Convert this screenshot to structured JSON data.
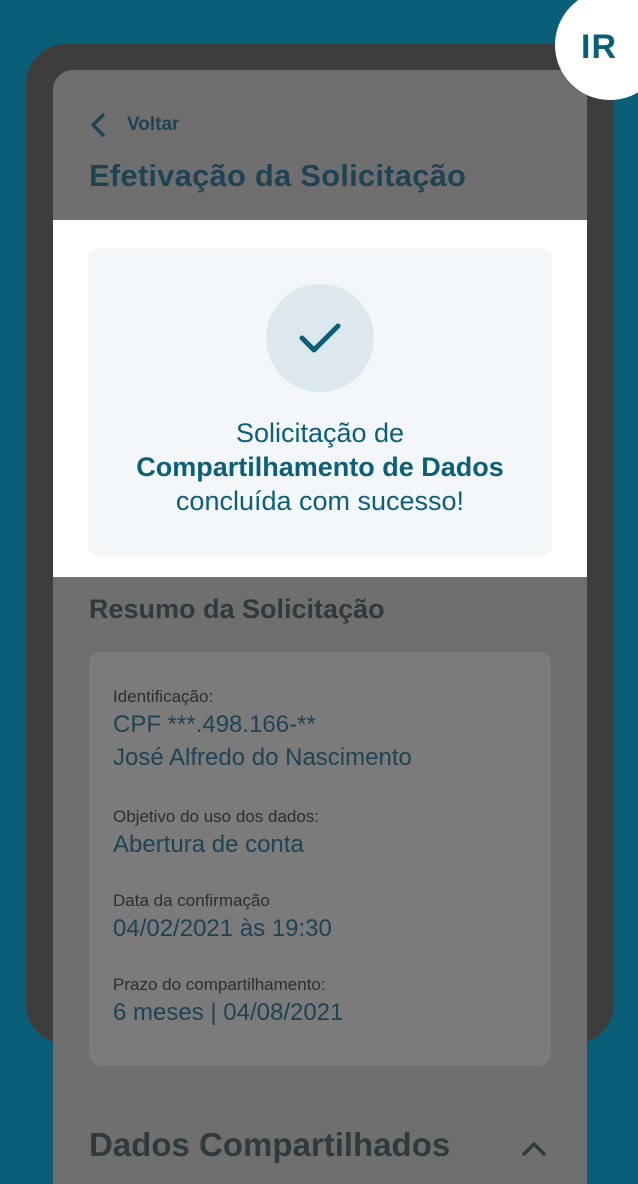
{
  "header": {
    "back_label": "Voltar",
    "title": "Efetivação da Solicitação"
  },
  "success": {
    "line1": "Solicitação de",
    "line2": "Compartilhamento de Dados",
    "line3": "concluída com sucesso!"
  },
  "summary": {
    "title": "Resumo da Solicitação",
    "fields": [
      {
        "label": "Identificação:",
        "values": [
          "CPF ***.498.166-**",
          "José Alfredo do Nascimento"
        ]
      },
      {
        "label": "Objetivo do uso dos dados:",
        "values": [
          "Abertura de conta"
        ]
      },
      {
        "label": "Data da confirmação",
        "values": [
          "04/02/2021 às 19:30"
        ]
      },
      {
        "label": "Prazo do compartilhamento:",
        "values": [
          "6 meses | 04/08/2021"
        ]
      }
    ]
  },
  "shared": {
    "title": "Dados Compartilhados"
  },
  "badge": {
    "text": "IR"
  },
  "icons": {
    "back": "chevron-left-icon",
    "check": "check-icon",
    "collapse": "chevron-up-icon"
  },
  "colors": {
    "background": "#0b5e78",
    "accent": "#0d5f78",
    "overlay": "#6f6f6f"
  }
}
